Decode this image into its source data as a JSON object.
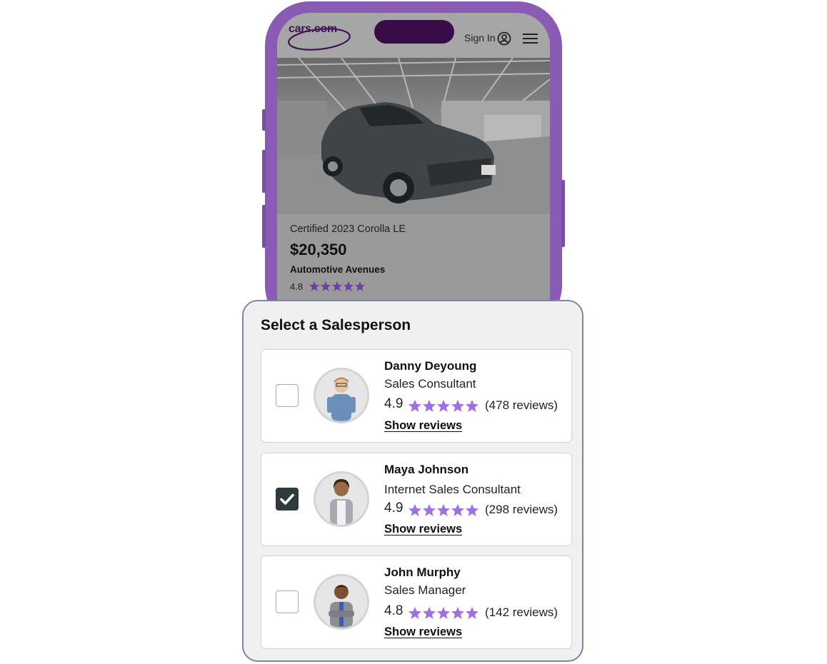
{
  "header": {
    "logo_text": "cars.com",
    "sign_in_label": "Sign In"
  },
  "listing": {
    "title": "Certified 2023 Corolla LE",
    "price": "$20,350",
    "dealer": "Automotive Avenues",
    "dealer_rating": "4.8",
    "dealer_stars": 5
  },
  "panel": {
    "title": "Select a Salesperson",
    "salespeople": [
      {
        "name": "Danny Deyoung",
        "role": "Sales Consultant",
        "rating": "4.9",
        "stars": 5,
        "reviews": "(478 reviews)",
        "link": "Show reviews",
        "selected": false
      },
      {
        "name": "Maya Johnson",
        "role": "Internet Sales Consultant",
        "rating": "4.9",
        "stars": 5,
        "reviews": "(298 reviews)",
        "link": "Show reviews",
        "selected": true
      },
      {
        "name": "John Murphy",
        "role": "Sales Manager",
        "rating": "4.8",
        "stars": 5,
        "reviews": "(142 reviews)",
        "link": "Show reviews",
        "selected": false
      }
    ]
  },
  "colors": {
    "brand": "#3e1253",
    "phone_frame": "#8a5bb5",
    "star_purple": "#a070e0",
    "star_dark": "#6b3fa8",
    "checked": "#2e3a3c"
  },
  "icons": [
    "user-circle-icon",
    "hamburger-menu-icon",
    "star-icon",
    "checkmark-icon"
  ]
}
